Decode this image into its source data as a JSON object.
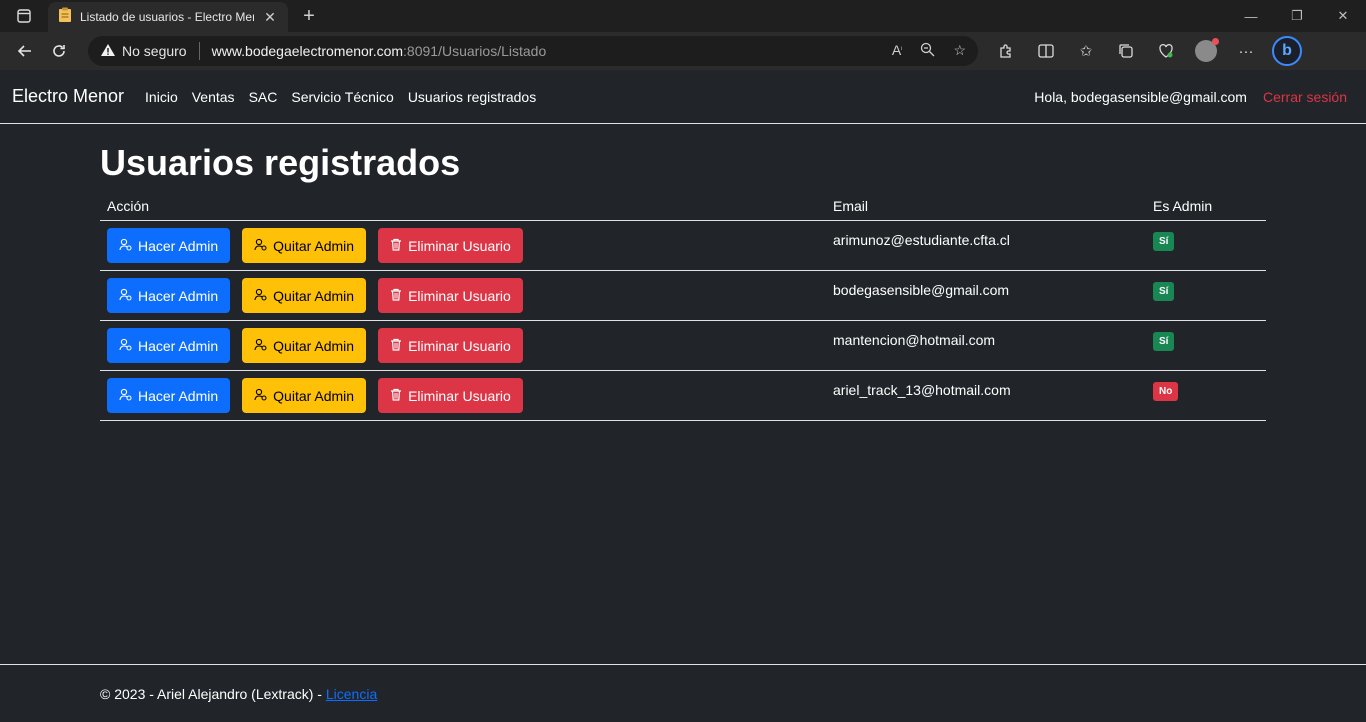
{
  "browser": {
    "tab_title": "Listado de usuarios - Electro Menor",
    "security_label": "No seguro",
    "url_host": "www.bodegaelectromenor.com",
    "url_path": ":8091/Usuarios/Listado"
  },
  "navbar": {
    "brand": "Electro Menor",
    "links": [
      "Inicio",
      "Ventas",
      "SAC",
      "Servicio Técnico",
      "Usuarios registrados"
    ],
    "greeting": "Hola, bodegasensible@gmail.com",
    "logout": "Cerrar sesión"
  },
  "page": {
    "title": "Usuarios registrados",
    "columns": [
      "Acción",
      "Email",
      "Es Admin"
    ],
    "buttons": {
      "make_admin": "Hacer Admin",
      "remove_admin": "Quitar Admin",
      "delete_user": "Eliminar Usuario"
    },
    "users": [
      {
        "email": "arimunoz@estudiante.cfta.cl",
        "admin": "Sí",
        "admin_color": "#198754"
      },
      {
        "email": "bodegasensible@gmail.com",
        "admin": "Sí",
        "admin_color": "#198754"
      },
      {
        "email": "mantencion@hotmail.com",
        "admin": "Sí",
        "admin_color": "#198754"
      },
      {
        "email": "ariel_track_13@hotmail.com",
        "admin": "No",
        "admin_color": "#dc3545"
      }
    ]
  },
  "footer": {
    "text": "© 2023 - Ariel Alejandro (Lextrack) - ",
    "link": "Licencia"
  },
  "colors": {
    "primary": "#0d6efd",
    "warning": "#ffc107",
    "danger": "#dc3545",
    "success": "#198754",
    "background": "#212529"
  }
}
